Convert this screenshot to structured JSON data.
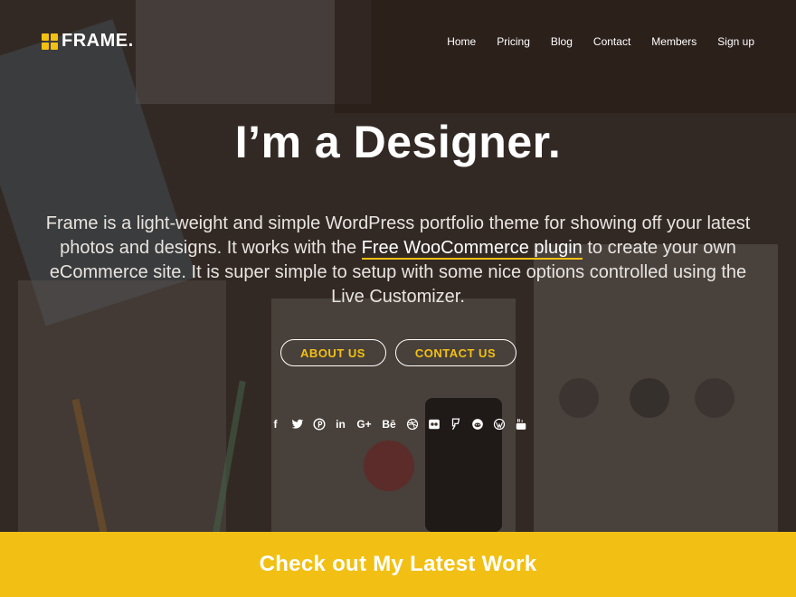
{
  "brand": {
    "name": "FRAME.",
    "accent": "#f2c014"
  },
  "nav": {
    "items": [
      {
        "label": "Home"
      },
      {
        "label": "Pricing"
      },
      {
        "label": "Blog"
      },
      {
        "label": "Contact"
      },
      {
        "label": "Members"
      },
      {
        "label": "Sign up"
      }
    ]
  },
  "hero": {
    "headline": "I’m a Designer.",
    "lead_before": "Frame is a light-weight and simple WordPress portfolio theme for showing off your latest photos and designs. It works with the ",
    "lead_link": "Free WooCommerce plugin",
    "lead_after": " to create your own eCommerce site. It is super simple to setup with some nice options controlled using the Live Customizer.",
    "about_label": "ABOUT US",
    "contact_label": "CONTACT US"
  },
  "social": {
    "icons": [
      "facebook-icon",
      "twitter-icon",
      "pinterest-icon",
      "linkedin-icon",
      "google-plus-icon",
      "behance-icon",
      "dribbble-icon",
      "flickr-icon",
      "foursquare-icon",
      "reddit-icon",
      "wordpress-icon",
      "youtube-icon"
    ],
    "text": {
      "linkedin": "in",
      "google_plus": "G+",
      "behance": "Bē",
      "facebook": "f"
    }
  },
  "band": {
    "title": "Check out My Latest Work",
    "color": "#f2c014"
  }
}
